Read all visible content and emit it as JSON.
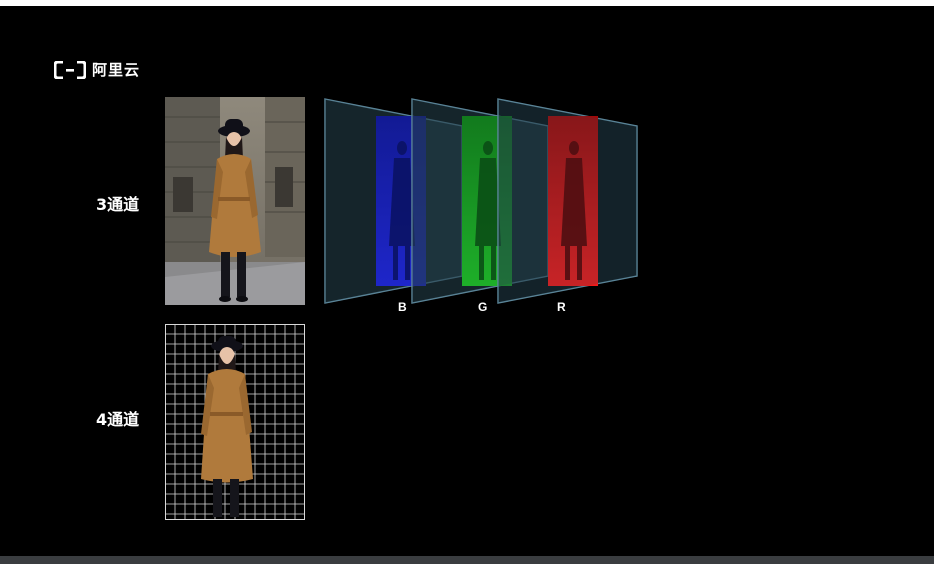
{
  "logo": {
    "text": "阿里云"
  },
  "rows": [
    {
      "label": "3通道"
    },
    {
      "label": "4通道"
    }
  ],
  "channels": [
    {
      "letter": "B",
      "color": "#1010e0"
    },
    {
      "letter": "G",
      "color": "#14c814"
    },
    {
      "letter": "R",
      "color": "#e01010"
    }
  ],
  "colors": {
    "background": "#000000",
    "coat": "#b07a3c",
    "grid": "#ffffff"
  }
}
